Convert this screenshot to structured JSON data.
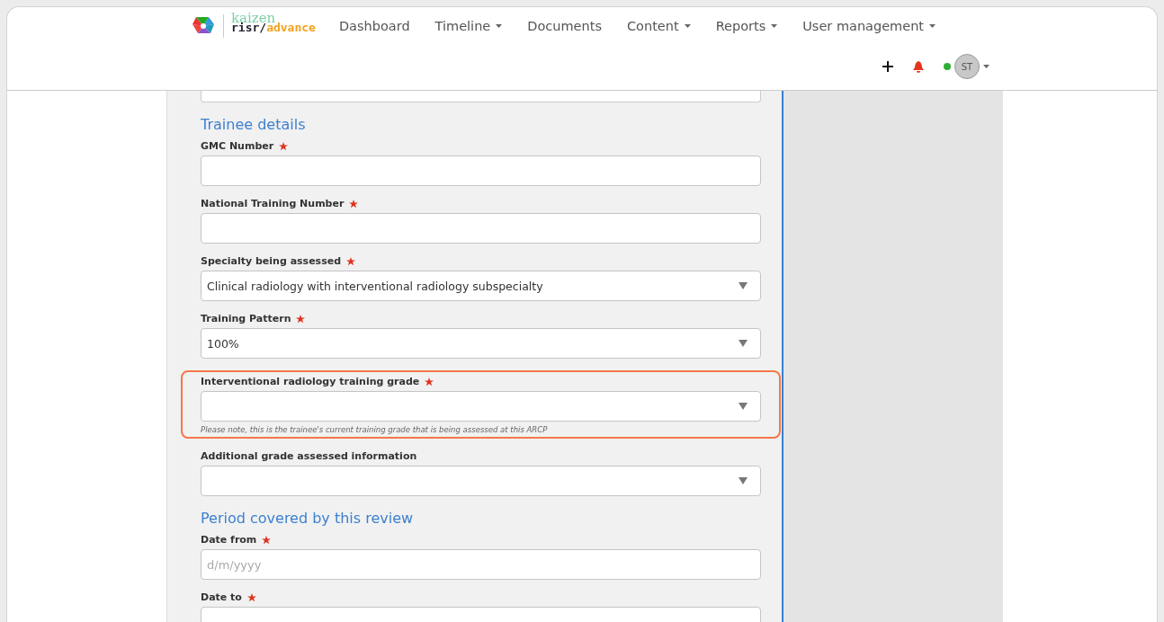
{
  "brand": {
    "top": "kaizen",
    "name": "risr/",
    "accent": "advance"
  },
  "nav": [
    {
      "label": "Dashboard",
      "dropdown": false
    },
    {
      "label": "Timeline",
      "dropdown": true
    },
    {
      "label": "Documents",
      "dropdown": false
    },
    {
      "label": "Content",
      "dropdown": true
    },
    {
      "label": "Reports",
      "dropdown": true
    },
    {
      "label": "User management",
      "dropdown": true
    }
  ],
  "user": {
    "initials": "ST",
    "online": true
  },
  "sections": [
    {
      "heading": "Trainee details",
      "fields": [
        {
          "label": "GMC Number",
          "required": true,
          "kind": "text",
          "highlighted": false
        },
        {
          "label": "National Training Number",
          "required": true,
          "kind": "text",
          "highlighted": false
        },
        {
          "label": "Specialty being assessed",
          "required": true,
          "kind": "select",
          "value": "Clinical radiology with interventional radiology subspecialty",
          "highlighted": false
        },
        {
          "label": "Training Pattern",
          "required": true,
          "kind": "select",
          "value": "100%",
          "highlighted": false
        },
        {
          "label": "Interventional radiology training grade",
          "required": true,
          "kind": "select",
          "highlighted": true,
          "note": "Please note, this is the trainee's current training grade that is being assessed at this ARCP"
        },
        {
          "label": "Additional grade assessed information",
          "required": false,
          "kind": "select",
          "highlighted": false
        }
      ]
    },
    {
      "heading": "Period covered by this review",
      "fields": [
        {
          "label": "Date from",
          "required": true,
          "kind": "text",
          "placeholder": "d/m/yyyy",
          "highlighted": false
        },
        {
          "label": "Date to",
          "required": true,
          "kind": "text",
          "highlighted": false
        }
      ]
    }
  ]
}
